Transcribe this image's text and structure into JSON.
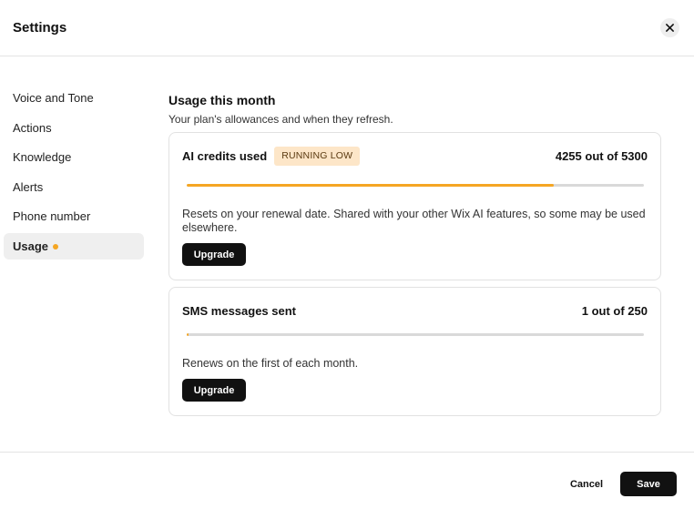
{
  "header": {
    "title": "Settings",
    "close_icon": "close-icon"
  },
  "sidebar": {
    "items": [
      {
        "label": "Voice and Tone"
      },
      {
        "label": "Actions"
      },
      {
        "label": "Knowledge"
      },
      {
        "label": "Alerts"
      },
      {
        "label": "Phone number"
      },
      {
        "label": "Usage",
        "active": true,
        "indicator_color": "#f5a623"
      }
    ]
  },
  "main": {
    "title": "Usage this month",
    "subtitle": "Your plan's allowances and when they refresh.",
    "cards": [
      {
        "title": "AI credits used",
        "badge": "RUNNING LOW",
        "count": "4255 out of 5300",
        "used": 4255,
        "limit": 5300,
        "description": "Resets on your renewal date. Shared with your other Wix AI features, so some may be used elsewhere.",
        "button_label": "Upgrade"
      },
      {
        "title": "SMS messages sent",
        "count": "1 out of 250",
        "used": 1,
        "limit": 250,
        "description": "Renews on the first of each month.",
        "button_label": "Upgrade"
      }
    ]
  },
  "footer": {
    "cancel_label": "Cancel",
    "save_label": "Save"
  },
  "colors": {
    "accent": "#f5a623",
    "badge_bg": "#fde6c8",
    "primary_button": "#111111"
  }
}
